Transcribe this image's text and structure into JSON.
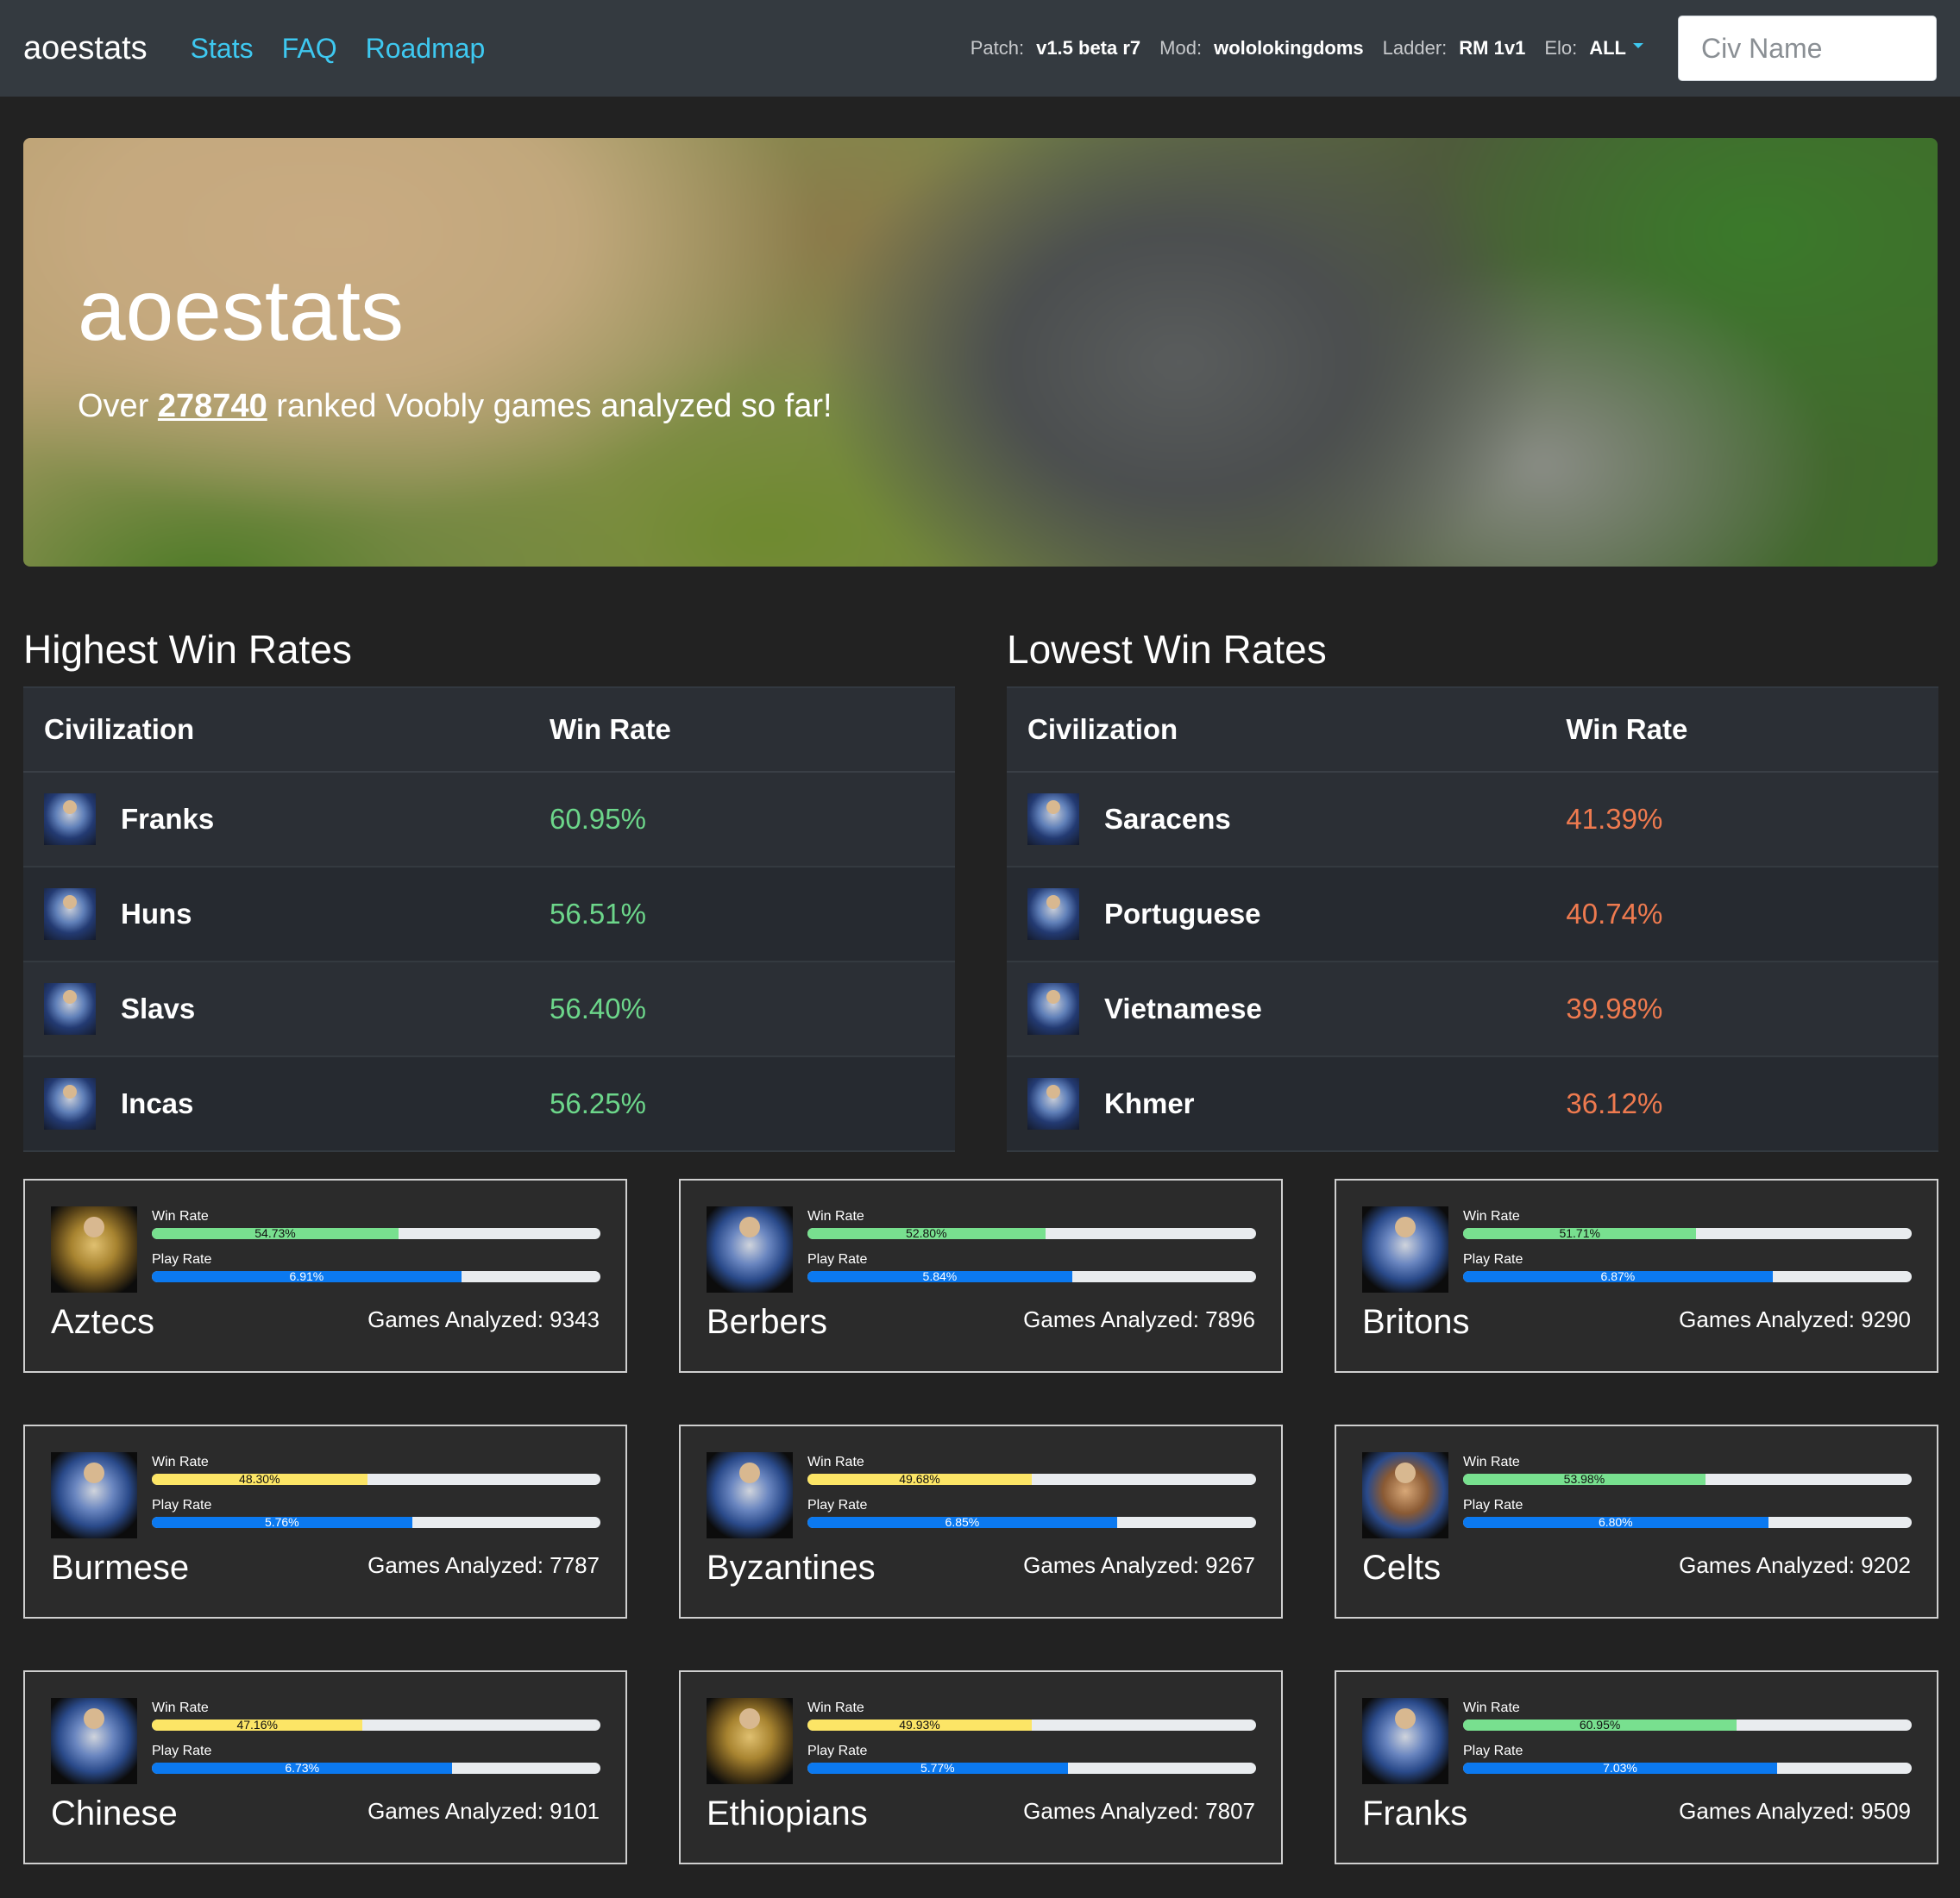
{
  "nav": {
    "brand": "aoestats",
    "links": [
      "Stats",
      "FAQ",
      "Roadmap"
    ],
    "patch_label": "Patch:",
    "patch_value": "v1.5 beta r7",
    "mod_label": "Mod:",
    "mod_value": "wololokingdoms",
    "ladder_label": "Ladder:",
    "ladder_value": "RM 1v1",
    "elo_label": "Elo:",
    "elo_value": "ALL",
    "search_placeholder": "Civ Name"
  },
  "hero": {
    "title": "aoestats",
    "sub_prefix": "Over ",
    "games_count": "278740",
    "sub_suffix": " ranked Voobly games analyzed so far!"
  },
  "highest": {
    "title": "Highest Win Rates",
    "col_civ": "Civilization",
    "col_rate": "Win Rate",
    "rows": [
      {
        "civ": "Franks",
        "rate": "60.95%"
      },
      {
        "civ": "Huns",
        "rate": "56.51%"
      },
      {
        "civ": "Slavs",
        "rate": "56.40%"
      },
      {
        "civ": "Incas",
        "rate": "56.25%"
      }
    ]
  },
  "lowest": {
    "title": "Lowest Win Rates",
    "col_civ": "Civilization",
    "col_rate": "Win Rate",
    "rows": [
      {
        "civ": "Saracens",
        "rate": "41.39%"
      },
      {
        "civ": "Portuguese",
        "rate": "40.74%"
      },
      {
        "civ": "Vietnamese",
        "rate": "39.98%"
      },
      {
        "civ": "Khmer",
        "rate": "36.12%"
      }
    ]
  },
  "cards": {
    "win_rate_label": "Win Rate",
    "play_rate_label": "Play Rate",
    "games_prefix": "Games Analyzed: ",
    "items": [
      {
        "civ": "Aztecs",
        "win": "54.73%",
        "win_frac": 0.55,
        "win_color": "green",
        "play": "6.91%",
        "play_frac": 0.69,
        "games": "9343",
        "icon": "gold"
      },
      {
        "civ": "Berbers",
        "win": "52.80%",
        "win_frac": 0.53,
        "win_color": "green",
        "play": "5.84%",
        "play_frac": 0.59,
        "games": "7896",
        "icon": "blue"
      },
      {
        "civ": "Britons",
        "win": "51.71%",
        "win_frac": 0.52,
        "win_color": "green",
        "play": "6.87%",
        "play_frac": 0.69,
        "games": "9290",
        "icon": "blue"
      },
      {
        "civ": "Burmese",
        "win": "48.30%",
        "win_frac": 0.48,
        "win_color": "yellow",
        "play": "5.76%",
        "play_frac": 0.58,
        "games": "7787",
        "icon": "blue"
      },
      {
        "civ": "Byzantines",
        "win": "49.68%",
        "win_frac": 0.5,
        "win_color": "yellow",
        "play": "6.85%",
        "play_frac": 0.69,
        "games": "9267",
        "icon": "blue"
      },
      {
        "civ": "Celts",
        "win": "53.98%",
        "win_frac": 0.54,
        "win_color": "green",
        "play": "6.80%",
        "play_frac": 0.68,
        "games": "9202",
        "icon": "brown"
      },
      {
        "civ": "Chinese",
        "win": "47.16%",
        "win_frac": 0.47,
        "win_color": "yellow",
        "play": "6.73%",
        "play_frac": 0.67,
        "games": "9101",
        "icon": "blue"
      },
      {
        "civ": "Ethiopians",
        "win": "49.93%",
        "win_frac": 0.5,
        "win_color": "yellow",
        "play": "5.77%",
        "play_frac": 0.58,
        "games": "7807",
        "icon": "gold"
      },
      {
        "civ": "Franks",
        "win": "60.95%",
        "win_frac": 0.61,
        "win_color": "green",
        "play": "7.03%",
        "play_frac": 0.7,
        "games": "9509",
        "icon": "blue"
      }
    ]
  },
  "colors": {
    "nav_bg": "#343a40",
    "link": "#3ec8f0",
    "rate_high": "#6cd68a",
    "rate_low": "#ee7a4f",
    "bar_green": "#78e08f",
    "bar_yellow": "#fce566",
    "bar_blue": "#0b79f0"
  }
}
